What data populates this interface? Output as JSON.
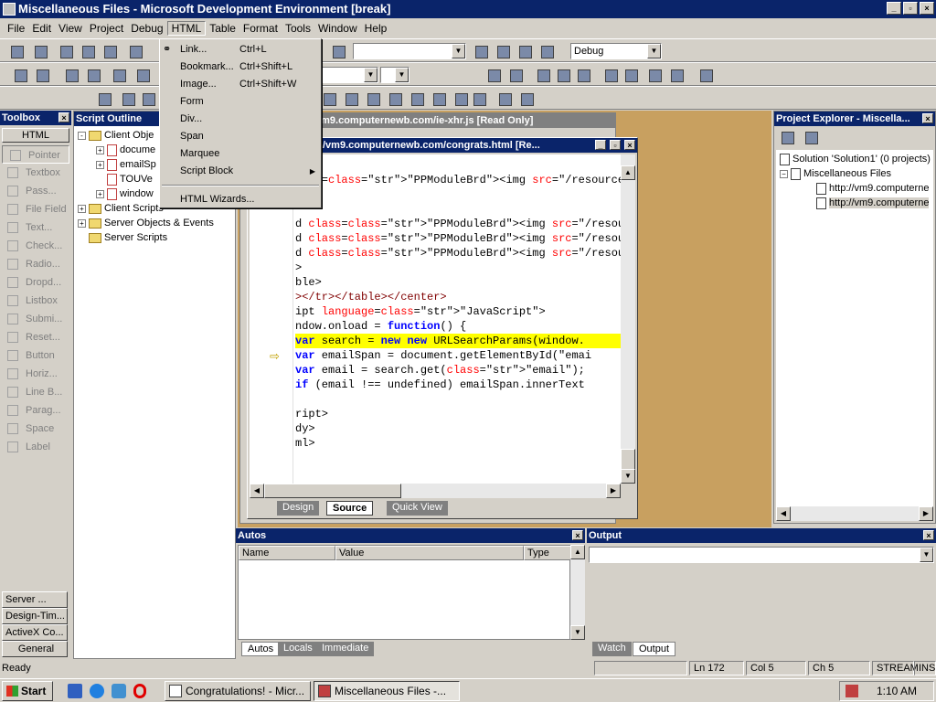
{
  "window": {
    "title": "Miscellaneous Files - Microsoft Development Environment [break]"
  },
  "menu": [
    "File",
    "Edit",
    "View",
    "Project",
    "Debug",
    "HTML",
    "Table",
    "Format",
    "Tools",
    "Window",
    "Help"
  ],
  "toolbar": {
    "config": "Debug"
  },
  "html_menu": [
    {
      "label": "Link...",
      "shortcut": "Ctrl+L"
    },
    {
      "label": "Bookmark...",
      "shortcut": "Ctrl+Shift+L"
    },
    {
      "label": "Image...",
      "shortcut": "Ctrl+Shift+W"
    },
    {
      "label": "Form",
      "shortcut": ""
    },
    {
      "label": "Div...",
      "shortcut": ""
    },
    {
      "label": "Span",
      "shortcut": ""
    },
    {
      "label": "Marquee",
      "shortcut": ""
    },
    {
      "label": "Script Block",
      "shortcut": ""
    },
    {
      "label": "HTML Wizards...",
      "shortcut": ""
    }
  ],
  "toolbox": {
    "title": "Toolbox",
    "tab": "HTML",
    "items": [
      "Pointer",
      "Textbox",
      "Pass...",
      "File Field",
      "Text...",
      "Check...",
      "Radio...",
      "Dropd...",
      "Listbox",
      "Submi...",
      "Reset...",
      "Button",
      "Horiz...",
      "Line B...",
      "Parag...",
      "Space",
      "Label"
    ],
    "bottom_tabs": [
      "Server ...",
      "Design-Tim...",
      "ActiveX Co...",
      "General"
    ]
  },
  "script_outline": {
    "title": "Script Outline",
    "items": [
      {
        "label": "Client Obje",
        "level": 0,
        "type": "folder",
        "expand": "-"
      },
      {
        "label": "docume",
        "level": 1,
        "type": "page",
        "expand": "+"
      },
      {
        "label": "emailSp",
        "level": 1,
        "type": "page",
        "expand": "+"
      },
      {
        "label": "TOUVe",
        "level": 1,
        "type": "page",
        "expand": ""
      },
      {
        "label": "window",
        "level": 1,
        "type": "page",
        "expand": "+"
      },
      {
        "label": "Client Scripts",
        "level": 0,
        "type": "folder",
        "expand": "+"
      },
      {
        "label": "Server Objects & Events",
        "level": 0,
        "type": "folder",
        "expand": "+"
      },
      {
        "label": "Server Scripts",
        "level": 0,
        "type": "folder",
        "expand": ""
      }
    ]
  },
  "doc_back": {
    "title": "vm9.computernewb.com/ie-xhr.js [Read Only]"
  },
  "doc_front": {
    "title": "/vm9.computernewb.com/congrats.html [Re..."
  },
  "code_lines": [
    "",
    "lass=\"PPModuleBrd\"><img src=\"/resources/in",
    ">",
    "",
    "d class=\"PPModuleBrd\"><img src=\"/resources/in",
    "d class=\"PPModuleBrd\"><img src=\"/resources/in",
    "d class=\"PPModuleBrd\"><img src=\"/resources/in",
    ">",
    "ble>",
    "></tr></table></center>",
    "ipt language=\"JavaScript\">",
    "ndow.onload = function() {",
    "var search = new new URLSearchParams(window.",
    "var emailSpan = document.getElementById(\"emai",
    "var email = search.get(\"email\");",
    "if (email !== undefined) emailSpan.innerText",
    "",
    "ript>",
    "dy>",
    "ml>"
  ],
  "editor_tabs": [
    "Design",
    "Source",
    "Quick View"
  ],
  "project_explorer": {
    "title": "Project Explorer - Miscella...",
    "items": [
      "Solution 'Solution1' (0 projects)",
      "Miscellaneous Files",
      "http://vm9.computerne",
      "http://vm9.computerne"
    ]
  },
  "autos": {
    "title": "Autos",
    "columns": [
      "Name",
      "Value",
      "Type"
    ],
    "tabs": [
      "Autos",
      "Locals",
      "Immediate"
    ]
  },
  "output": {
    "title": "Output",
    "tabs": [
      "Watch",
      "Output"
    ]
  },
  "status": {
    "text": "Ready",
    "ln": "Ln 172",
    "col": "Col 5",
    "ch": "Ch 5",
    "mode": "STREAM",
    "ins": "INS"
  },
  "taskbar": {
    "start": "Start",
    "tasks": [
      "Congratulations! - Micr...",
      "Miscellaneous Files -..."
    ],
    "time": "1:10 AM"
  },
  "colors": {
    "title_active": "#0a246a",
    "highlight": "#ffff00",
    "doc_bg": "#c8a060"
  }
}
